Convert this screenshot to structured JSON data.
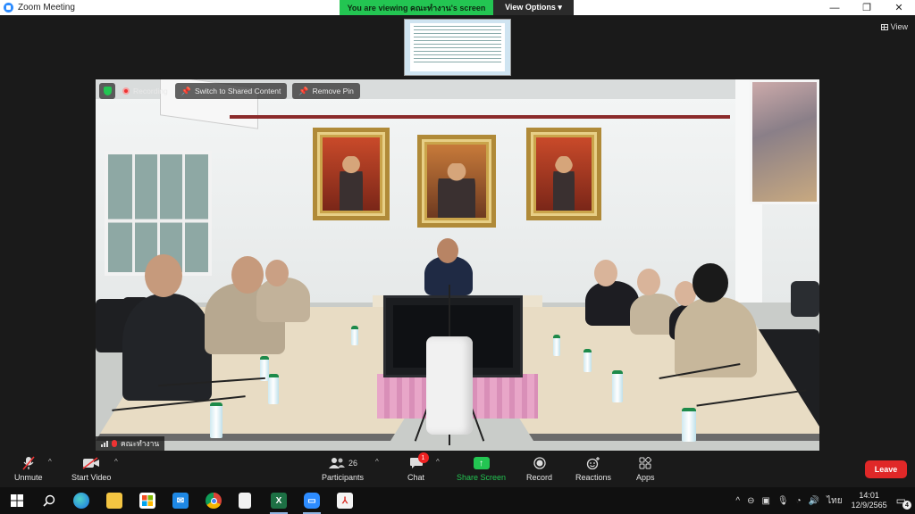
{
  "window": {
    "title": "Zoom Meeting",
    "controls": [
      "minimize-icon",
      "restore-icon",
      "close-icon"
    ]
  },
  "share_banner": {
    "message": "You are viewing คณะทำงาน's screen",
    "view_options": "View Options ▾"
  },
  "view_button": "View",
  "video_overlay": {
    "recording": "Recording",
    "switch_shared": "Switch to Shared Content",
    "remove_pin": "Remove Pin",
    "participant_name": "คณะทำงาน"
  },
  "controls": {
    "unmute": "Unmute",
    "start_video": "Start Video",
    "participants": "Participants",
    "participants_count": "26",
    "chat": "Chat",
    "chat_badge": "1",
    "share_screen": "Share Screen",
    "record": "Record",
    "reactions": "Reactions",
    "apps": "Apps",
    "leave": "Leave"
  },
  "taskbar": {
    "apps": [
      "windows-start",
      "search",
      "edge",
      "file-explorer",
      "store",
      "mail",
      "chrome",
      "file",
      "excel",
      "zoom",
      "pdf"
    ],
    "language": "ไทย",
    "time": "14:01",
    "date": "12/9/2565",
    "notifications": "4"
  },
  "colors": {
    "zoom_green": "#23c552",
    "leave_red": "#e02828",
    "zoom_blue": "#2d8cff"
  }
}
